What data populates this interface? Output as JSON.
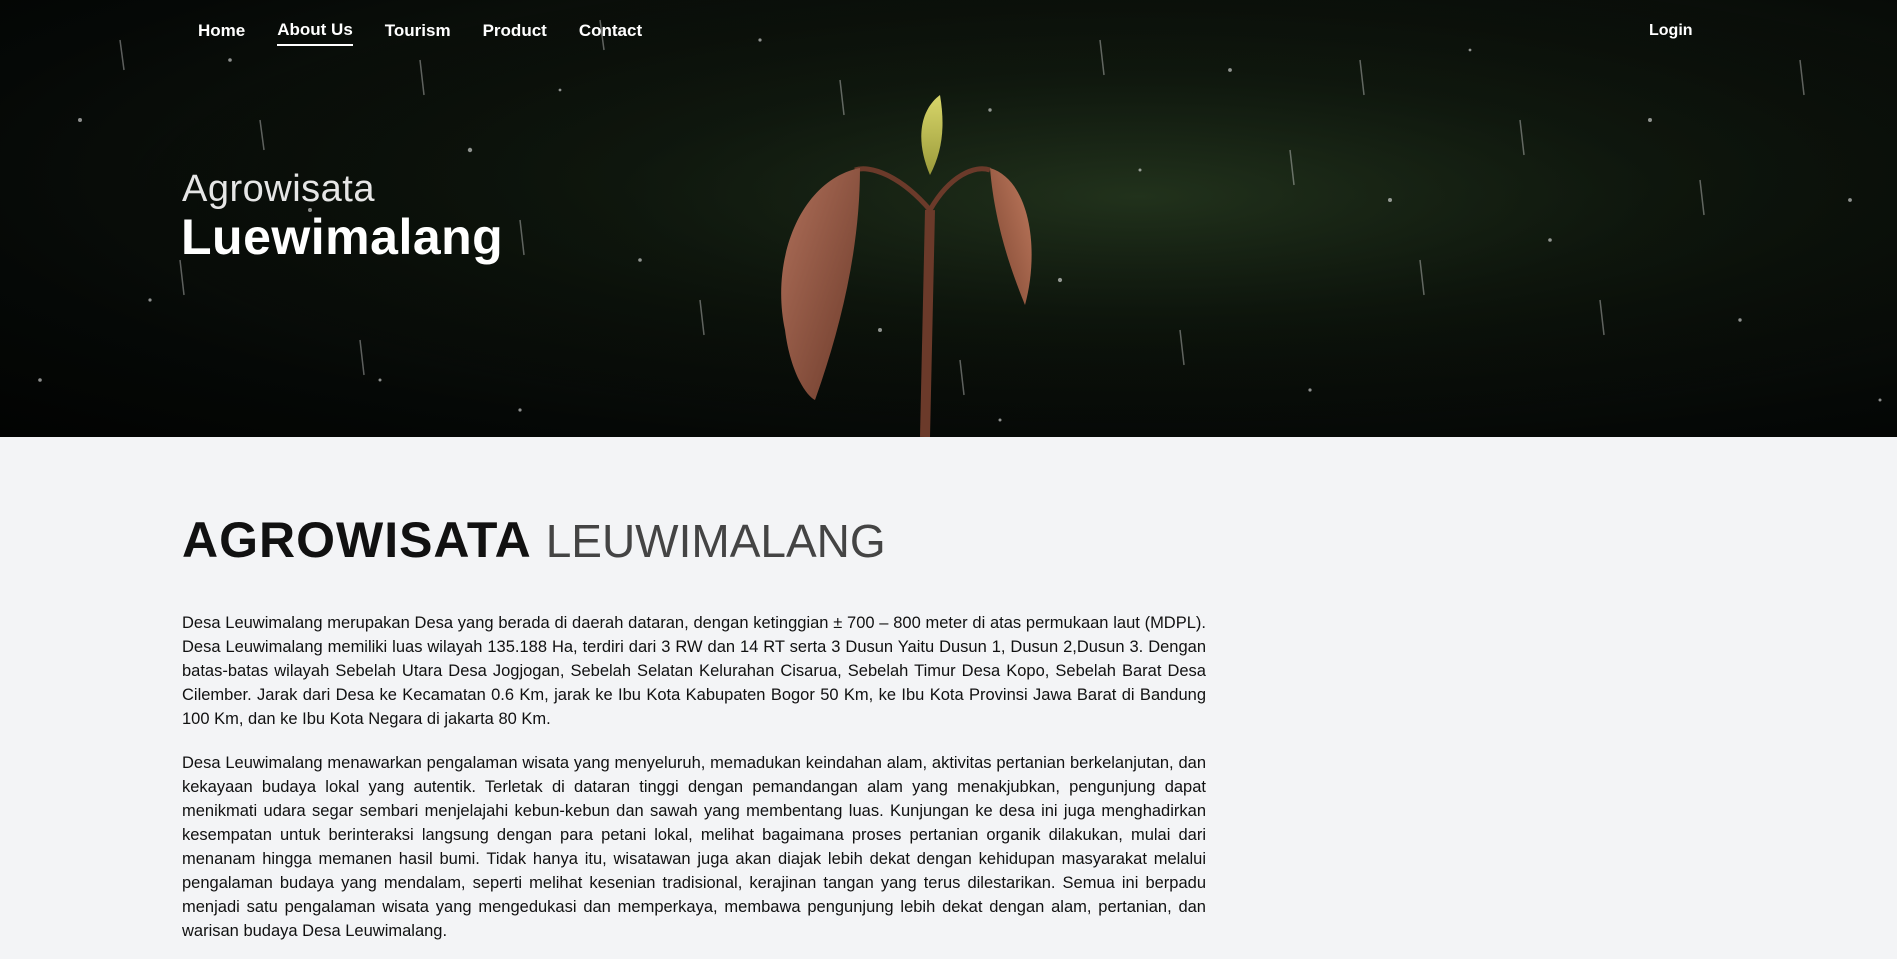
{
  "nav": {
    "items": [
      {
        "label": "Home",
        "active": false
      },
      {
        "label": "About Us",
        "active": true
      },
      {
        "label": "Tourism",
        "active": false
      },
      {
        "label": "Product",
        "active": false
      },
      {
        "label": "Contact",
        "active": false
      }
    ],
    "login_label": "Login"
  },
  "hero": {
    "subtitle": "Agrowisata",
    "title": "Luewimalang"
  },
  "section": {
    "title_bold": "AGROWISATA",
    "title_thin": "LEUWIMALANG",
    "paragraphs": [
      "Desa Leuwimalang merupakan Desa yang berada di daerah dataran, dengan ketinggian ± 700 – 800 meter di atas permukaan laut (MDPL). Desa Leuwimalang memiliki luas wilayah 135.188 Ha, terdiri dari 3 RW dan 14 RT serta 3 Dusun Yaitu Dusun 1, Dusun 2,Dusun 3. Dengan batas-batas wilayah Sebelah Utara Desa Jogjogan, Sebelah Selatan Kelurahan Cisarua, Sebelah Timur Desa Kopo, Sebelah Barat Desa Cilember. Jarak dari Desa ke Kecamatan 0.6 Km, jarak ke Ibu Kota Kabupaten Bogor 50 Km, ke Ibu Kota Provinsi Jawa Barat di Bandung 100 Km, dan ke Ibu Kota Negara di jakarta 80 Km.",
      "Desa Leuwimalang menawarkan pengalaman wisata yang menyeluruh, memadukan keindahan alam, aktivitas pertanian berkelanjutan, dan kekayaan budaya lokal yang autentik. Terletak di dataran tinggi dengan pemandangan alam yang menakjubkan, pengunjung dapat menikmati udara segar sembari menjelajahi kebun-kebun dan sawah yang membentang luas. Kunjungan ke desa ini juga menghadirkan kesempatan untuk berinteraksi langsung dengan para petani lokal, melihat bagaimana proses pertanian organik dilakukan, mulai dari menanam hingga memanen hasil bumi. Tidak hanya itu, wisatawan juga akan diajak lebih dekat dengan kehidupan masyarakat melalui pengalaman budaya yang mendalam, seperti melihat kesenian tradisional, kerajinan tangan yang terus dilestarikan. Semua ini berpadu menjadi satu pengalaman wisata yang mengedukasi dan memperkaya, membawa pengunjung lebih dekat dengan alam, pertanian, dan warisan budaya Desa Leuwimalang."
    ]
  },
  "colors": {
    "page_bg": "#f3f4f6",
    "hero_bg": "#0a0f09",
    "nav_text": "#ffffff",
    "body_text": "#111111"
  }
}
